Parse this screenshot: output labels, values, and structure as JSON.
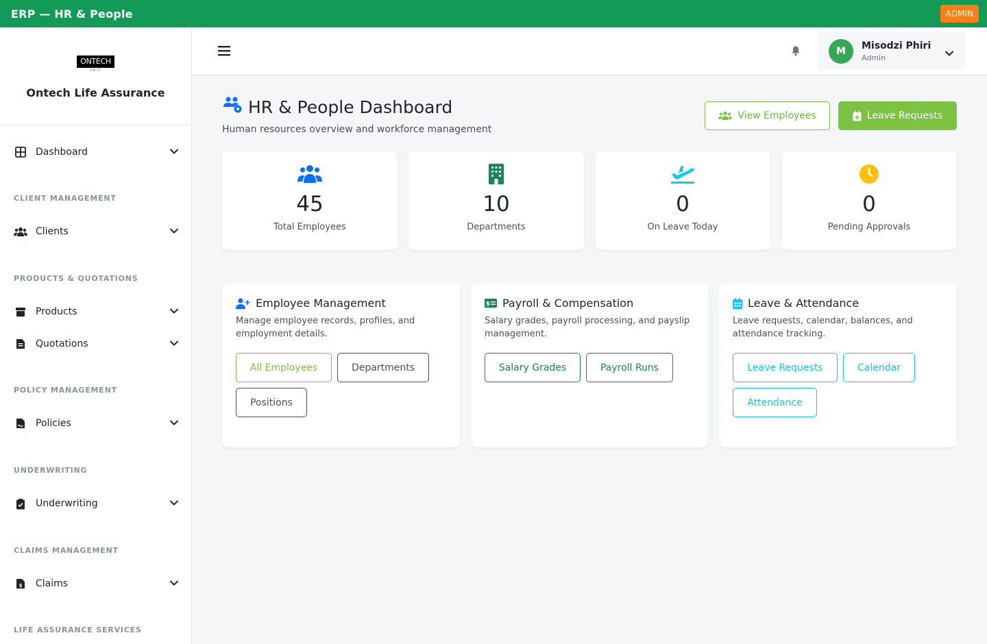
{
  "topbar": {
    "title": "ERP — HR & People",
    "badge": "ADMIN"
  },
  "sidebar": {
    "logo_text": "ONTECH",
    "logo_sub": "ON.IT",
    "company": "Ontech Life Assurance",
    "items": [
      {
        "label": "Dashboard",
        "icon": "grid-icon"
      },
      {
        "label": "Clients",
        "icon": "users-icon"
      },
      {
        "label": "Products",
        "icon": "box-icon"
      },
      {
        "label": "Quotations",
        "icon": "file-icon"
      },
      {
        "label": "Policies",
        "icon": "file-contract-icon"
      },
      {
        "label": "Underwriting",
        "icon": "clipboard-check-icon"
      },
      {
        "label": "Claims",
        "icon": "file-invoice-dollar-icon"
      }
    ],
    "sections": [
      "CLIENT MANAGEMENT",
      "PRODUCTS & QUOTATIONS",
      "POLICY MANAGEMENT",
      "UNDERWRITING",
      "CLAIMS MANAGEMENT",
      "LIFE ASSURANCE SERVICES"
    ]
  },
  "header": {
    "user": {
      "initial": "M",
      "name": "Misodzi Phiri",
      "role": "Admin"
    }
  },
  "page": {
    "title": "HR & People Dashboard",
    "subtitle": "Human resources overview and workforce management",
    "view_employees": "View Employees",
    "leave_requests": "Leave Requests"
  },
  "stats": [
    {
      "value": "45",
      "label": "Total Employees",
      "icon": "users-icon",
      "color": "#0d6efd"
    },
    {
      "value": "10",
      "label": "Departments",
      "icon": "building-icon",
      "color": "#198754"
    },
    {
      "value": "0",
      "label": "On Leave Today",
      "icon": "plane-departure-icon",
      "color": "#0dcaf0"
    },
    {
      "value": "0",
      "label": "Pending Approvals",
      "icon": "clock-icon",
      "color": "#ffc107"
    }
  ],
  "cards": [
    {
      "title": "Employee Management",
      "desc": "Manage employee records, profiles, and employment details.",
      "buttons": [
        "All Employees",
        "Departments",
        "Positions"
      ]
    },
    {
      "title": "Payroll & Compensation",
      "desc": "Salary grades, payroll processing, and payslip management.",
      "buttons": [
        "Salary Grades",
        "Payroll Runs"
      ]
    },
    {
      "title": "Leave & Attendance",
      "desc": "Leave requests, calendar, balances, and attendance tracking.",
      "buttons": [
        "Leave Requests",
        "Calendar",
        "Attendance"
      ]
    }
  ],
  "colors": {
    "topbar": "#139a56",
    "admin_badge": "#fd7e14",
    "accent_green": "#7cc243"
  }
}
